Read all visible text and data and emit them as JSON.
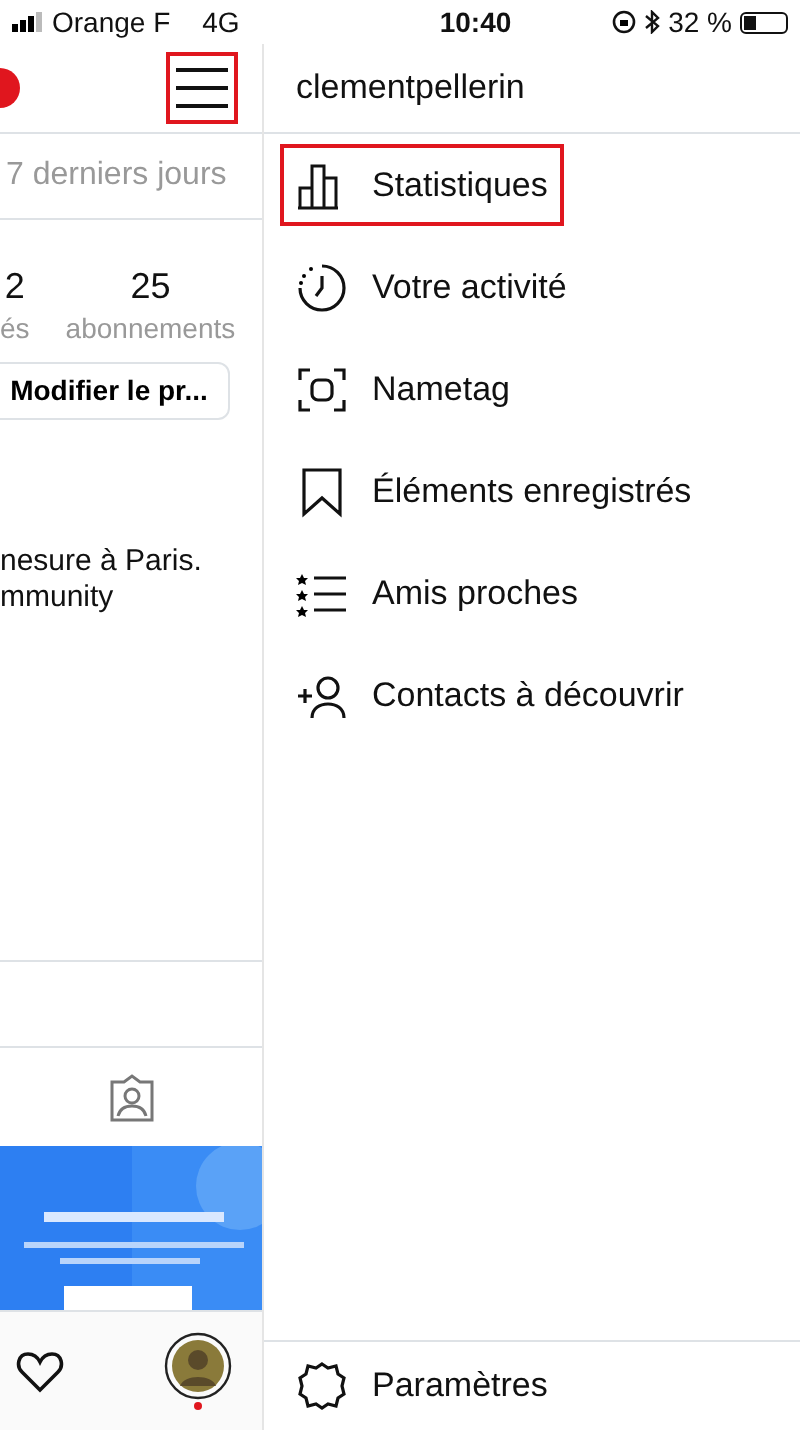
{
  "status_bar": {
    "carrier": "Orange F",
    "network": "4G",
    "time": "10:40",
    "battery": "32 %"
  },
  "profile": {
    "menu_button": {
      "highlighted": true
    },
    "period": "7 derniers jours",
    "stats": [
      {
        "value": "2",
        "label": "és"
      },
      {
        "value": "25",
        "label": "abonnements"
      }
    ],
    "edit_button": "Modifier le pr...",
    "bio": [
      "nesure à Paris.",
      "mmunity"
    ]
  },
  "drawer": {
    "username": "clementpellerin",
    "items": [
      {
        "kind": "chart",
        "label": "Statistiques",
        "highlighted": true
      },
      {
        "kind": "activity",
        "label": "Votre activité",
        "highlighted": false
      },
      {
        "kind": "nametag",
        "label": "Nametag",
        "highlighted": false
      },
      {
        "kind": "saved",
        "label": "Éléments enregistrés",
        "highlighted": false
      },
      {
        "kind": "friends",
        "label": "Amis proches",
        "highlighted": false
      },
      {
        "kind": "discover",
        "label": "Contacts à découvrir",
        "highlighted": false
      }
    ],
    "settings": "Paramètres"
  }
}
